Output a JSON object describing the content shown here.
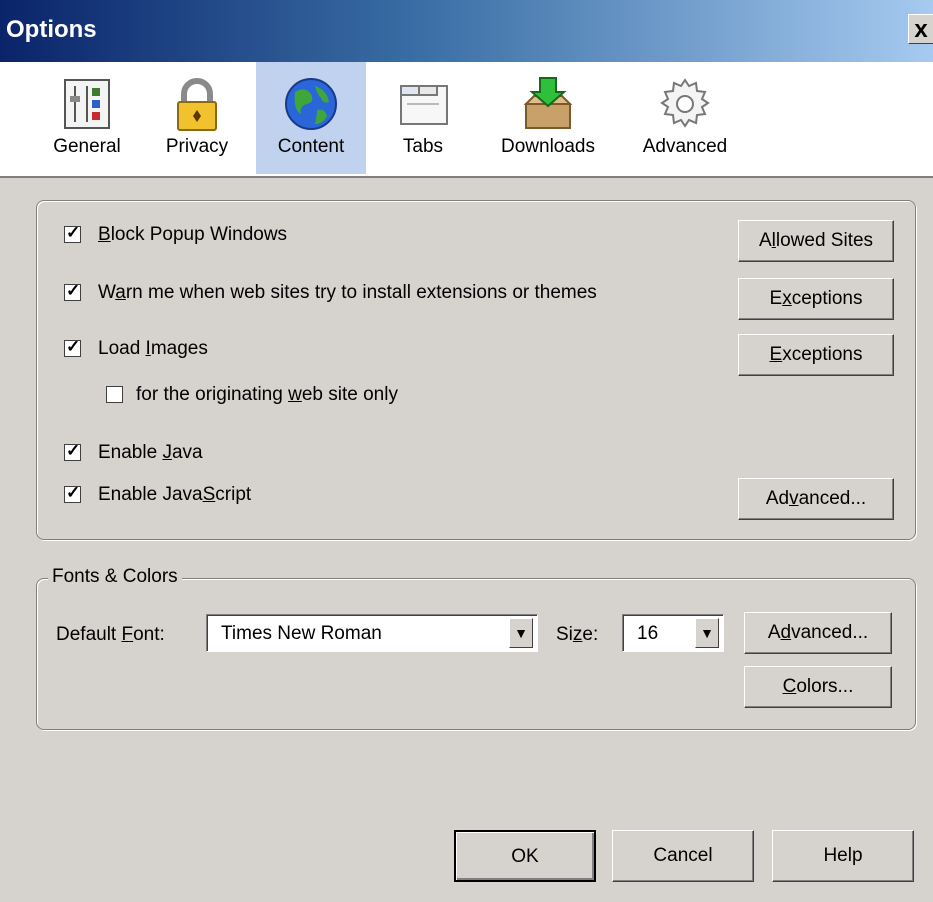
{
  "window": {
    "title": "Options",
    "close_glyph": "x"
  },
  "tabs": [
    {
      "label": "General",
      "icon": "general-settings-icon"
    },
    {
      "label": "Privacy",
      "icon": "padlock-icon"
    },
    {
      "label": "Content",
      "icon": "globe-icon",
      "selected": true
    },
    {
      "label": "Tabs",
      "icon": "tabs-window-icon"
    },
    {
      "label": "Downloads",
      "icon": "download-box-icon"
    },
    {
      "label": "Advanced",
      "icon": "gear-icon"
    }
  ],
  "content": {
    "block_popups": {
      "label_pre": "",
      "accel": "B",
      "label_post": "lock Popup Windows",
      "checked": true
    },
    "warn_extensions": {
      "label_pre": "W",
      "accel": "a",
      "label_post": "rn me when web sites try to install extensions or themes",
      "checked": true
    },
    "load_images": {
      "label_pre": "Load ",
      "accel": "I",
      "label_post": "mages",
      "checked": true
    },
    "originating_only": {
      "label_pre": "for the originating ",
      "accel": "w",
      "label_post": "eb site only",
      "checked": false
    },
    "enable_java": {
      "label_pre": "Enable ",
      "accel": "J",
      "label_post": "ava",
      "checked": true
    },
    "enable_javascript": {
      "label_pre": "Enable Java",
      "accel": "S",
      "label_post": "cript",
      "checked": true
    },
    "allowed_sites_button": {
      "pre": "A",
      "accel": "l",
      "post": "lowed Sites"
    },
    "exceptions1_button": {
      "pre": "E",
      "accel": "x",
      "post": "ceptions"
    },
    "exceptions2_button": {
      "pre": "",
      "accel": "E",
      "post": "xceptions"
    },
    "advanced_js_button": {
      "pre": "Ad",
      "accel": "v",
      "post": "anced..."
    }
  },
  "fonts_colors": {
    "legend": "Fonts & Colors",
    "default_font_label": {
      "pre": "Default ",
      "accel": "F",
      "post": "ont:"
    },
    "default_font_value": "Times New Roman",
    "size_label": {
      "pre": "Si",
      "accel": "z",
      "post": "e:"
    },
    "size_value": "16",
    "advanced_button": {
      "pre": "A",
      "accel": "d",
      "post": "vanced..."
    },
    "colors_button": {
      "pre": "",
      "accel": "C",
      "post": "olors..."
    }
  },
  "footer": {
    "ok": "OK",
    "cancel": "Cancel",
    "help": "Help"
  }
}
